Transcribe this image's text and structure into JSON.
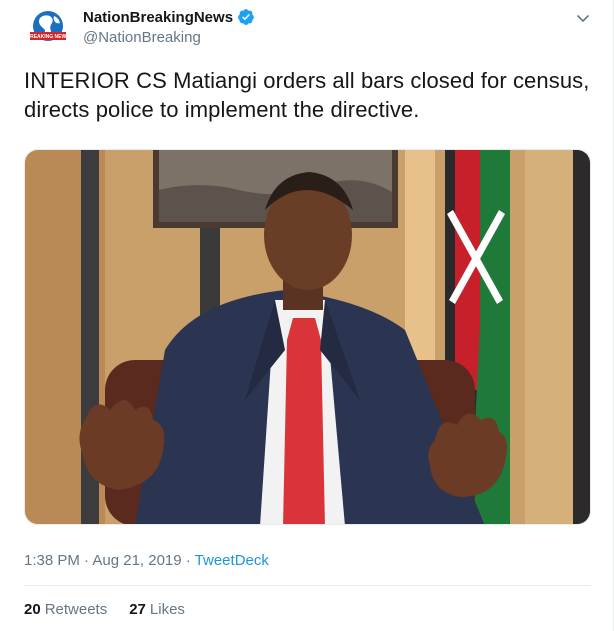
{
  "user": {
    "name": "NationBreakingNews",
    "handle": "@NationBreaking",
    "avatar_text": "BREAKING NEWS"
  },
  "tweet": {
    "text": "INTERIOR CS Matiangi orders all bars closed for census, directs police to implement the directive.",
    "time": "1:38 PM · Aug 21, 2019 · ",
    "source": "TweetDeck"
  },
  "stats": {
    "retweets_count": "20",
    "retweets_label": "Retweets",
    "likes_count": "27",
    "likes_label": "Likes"
  },
  "icons": {
    "verified": "verified-badge-icon",
    "caret": "chevron-down-icon"
  },
  "colors": {
    "accent": "#1b95e0",
    "muted": "#657786",
    "text": "#14171a",
    "divider": "#e6ecf0"
  }
}
